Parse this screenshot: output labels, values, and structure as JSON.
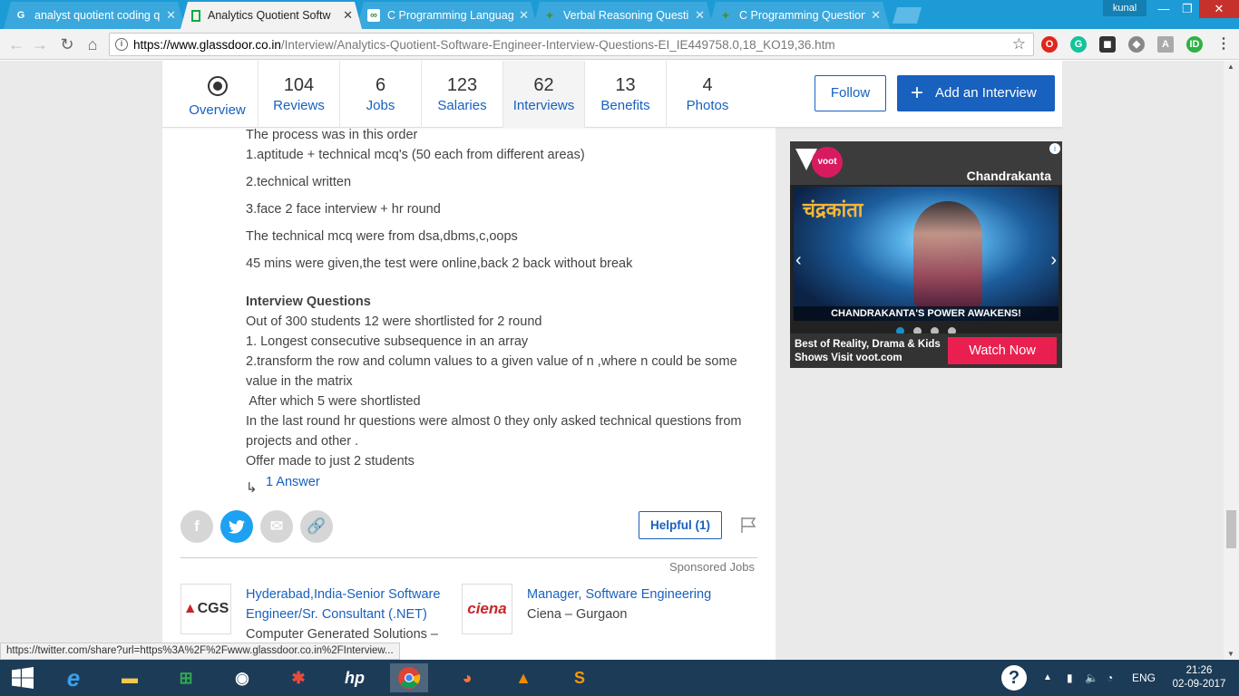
{
  "browser": {
    "tabs": [
      {
        "title": "analyst quotient coding q",
        "icon": "google-icon"
      },
      {
        "title": "Analytics Quotient Softw",
        "icon": "glassdoor-icon"
      },
      {
        "title": "C Programming Languag",
        "icon": "geeksforgeeks-icon"
      },
      {
        "title": "Verbal Reasoning Questi",
        "icon": "indiabix-icon"
      },
      {
        "title": "C Programming Question",
        "icon": "indiabix-icon"
      }
    ],
    "user": "kunal",
    "url_host": "https://www.glassdoor.co.in",
    "url_path": "/Interview/Analytics-Quotient-Software-Engineer-Interview-Questions-EI_IE449758.0,18_KO19,36.htm",
    "status_url": "https://twitter.com/share?url=https%3A%2F%2Fwww.glassdoor.co.in%2FInterview..."
  },
  "subnav": {
    "overview": "Overview",
    "items": [
      {
        "count": "104",
        "label": "Reviews"
      },
      {
        "count": "6",
        "label": "Jobs"
      },
      {
        "count": "123",
        "label": "Salaries"
      },
      {
        "count": "62",
        "label": "Interviews"
      },
      {
        "count": "13",
        "label": "Benefits"
      },
      {
        "count": "4",
        "label": "Photos"
      }
    ],
    "follow": "Follow",
    "add_interview": "Add an Interview"
  },
  "interview": {
    "process_lines": [
      "The process was in this order",
      "1.aptitude + technical mcq's (50 each from different areas)",
      "2.technical written",
      "3.face 2 face interview + hr round",
      "The technical mcq were from dsa,dbms,c,oops",
      "45 mins were given,the test were online,back 2 back without break"
    ],
    "questions_heading": "Interview Questions",
    "question_lines": [
      "Out of 300 students 12 were shortlisted for 2 round",
      "1. Longest consecutive subsequence in an array",
      "2.transform the row and column values to a given value of n ,where n could be some",
      "value in the matrix",
      " After which 5 were shortlisted",
      "In the last round hr questions were almost 0 they only asked technical questions from",
      "projects and other .",
      "Offer made to just 2 students"
    ],
    "answers_link": "1 Answer",
    "helpful": "Helpful (1)"
  },
  "sponsored": {
    "heading": "Sponsored Jobs",
    "jobs": [
      {
        "logo": "CGS",
        "title_line1": "Hyderabad,India-Senior Software",
        "title_line2": "Engineer/Sr. Consultant (.NET)",
        "company": "Computer Generated Solutions –"
      },
      {
        "logo": "ciena",
        "title_line1": "Manager, Software Engineering",
        "company": "Ciena – Gurgaon"
      }
    ]
  },
  "ad": {
    "brand": "voot",
    "show": "Chandrakanta",
    "hindi_title": "चंद्रकांता",
    "caption": "CHANDRAKANTA'S POWER AWAKENS!",
    "promo_line1": "Best of Reality, Drama & Kids",
    "promo_line2": "Shows Visit voot.com",
    "cta": "Watch Now"
  },
  "taskbar": {
    "lang": "ENG",
    "time": "21:26",
    "date": "02-09-2017"
  },
  "colors": {
    "link_blue": "#1861bf",
    "chrome_blue": "#1d9bd6",
    "ad_cta": "#e9204f",
    "twitter": "#1da1f2"
  }
}
